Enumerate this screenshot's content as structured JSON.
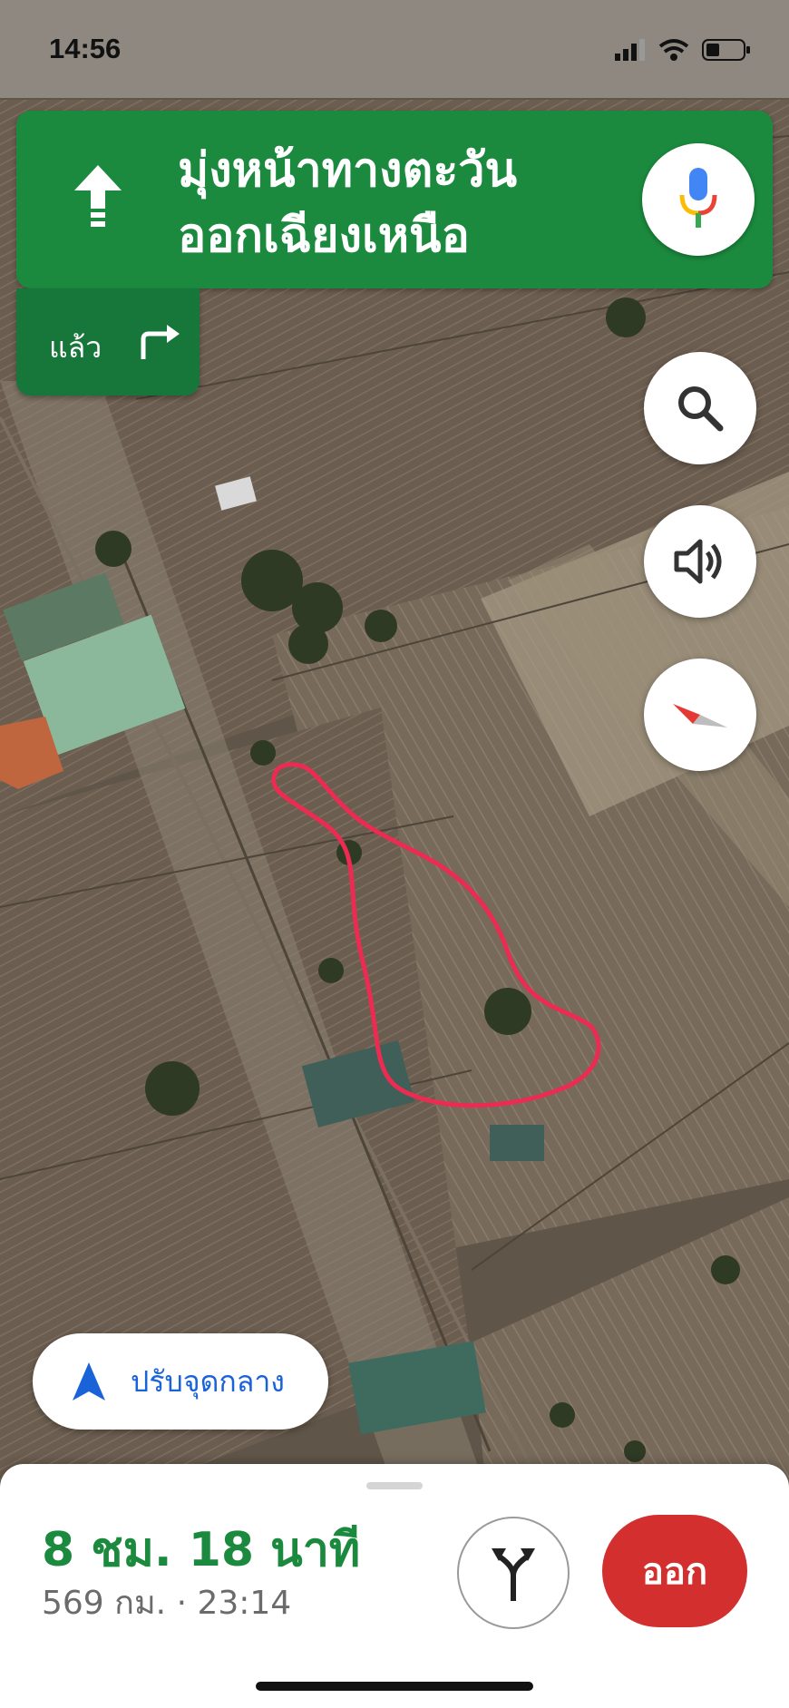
{
  "status_bar": {
    "time": "14:56"
  },
  "navigation": {
    "instruction": "มุ่งหน้าทางตะวัน\nออกเฉียงเหนือ",
    "then_label": "แล้ว",
    "direction_icon": "straight-arrow-icon",
    "then_icon": "turn-right-icon",
    "banner_color": "#1b8a3e"
  },
  "controls": {
    "mic_icon": "google-mic-icon",
    "search_icon": "search-icon",
    "sound_icon": "speaker-icon",
    "compass_icon": "compass-icon"
  },
  "recenter": {
    "label": "ปรับจุดกลาง"
  },
  "trip": {
    "duration": "8 ชม. 18 นาที",
    "details": "569 กม. · 23:14",
    "exit_label": "ออก",
    "alt_routes_icon": "alternate-routes-icon",
    "eta_color": "#1b8a3e",
    "exit_color": "#d32f2f"
  }
}
